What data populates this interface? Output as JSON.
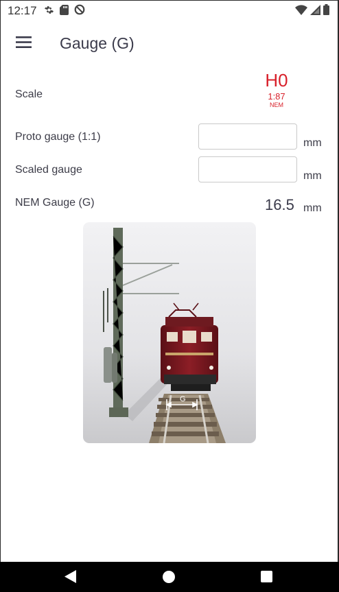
{
  "status_bar": {
    "time": "12:17",
    "left_icons": [
      "gear-icon",
      "sd-card-icon",
      "data-saver-icon"
    ],
    "right_icons": [
      "wifi-icon",
      "signal-icon",
      "battery-icon"
    ]
  },
  "app_bar": {
    "title": "Gauge (G)",
    "menu_icon": "hamburger-menu-icon"
  },
  "scale": {
    "label": "Scale",
    "value": "H0",
    "ratio": "1:87",
    "standard": "NEM",
    "color": "#d8202a"
  },
  "proto_gauge": {
    "label": "Proto gauge (1:1)",
    "value": "",
    "placeholder": "",
    "unit": "mm"
  },
  "scaled_gauge": {
    "label": "Scaled gauge",
    "value": "",
    "placeholder": "",
    "unit": "mm"
  },
  "nem_gauge": {
    "label": "NEM Gauge (G)",
    "value": "16.5",
    "unit": "mm"
  },
  "photo": {
    "gauge_marker": "G"
  },
  "nav_bar": {
    "buttons": [
      "back-icon",
      "home-icon",
      "recents-icon"
    ]
  }
}
